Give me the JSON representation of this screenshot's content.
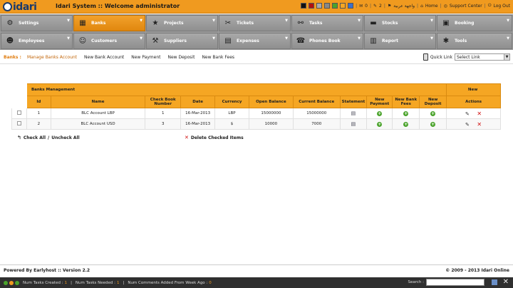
{
  "header": {
    "logo_text": "idari",
    "title": "Idari System :: Welcome administrator",
    "swatches": [
      "#111111",
      "#b01010",
      "#aaaaaa",
      "#888888",
      "#4aa32b",
      "#f5a623",
      "#3c6fc9"
    ],
    "msg_count": "0",
    "task_count": "2",
    "arabic_label": "واجهة عربية",
    "home": "Home",
    "support": "Support Center",
    "logout": "Log Out"
  },
  "menu": {
    "row1": [
      {
        "label": "Settings",
        "icon": "wrench-icon"
      },
      {
        "label": "Banks",
        "icon": "bank-icon"
      },
      {
        "label": "Projects",
        "icon": "star-icon"
      },
      {
        "label": "Tickets",
        "icon": "ticket-icon"
      },
      {
        "label": "Tasks",
        "icon": "tasks-icon"
      },
      {
        "label": "Stocks",
        "icon": "truck-icon"
      },
      {
        "label": "Booking",
        "icon": "booking-icon"
      }
    ],
    "row2": [
      {
        "label": "Employees",
        "icon": "employees-icon"
      },
      {
        "label": "Customers",
        "icon": "customers-icon"
      },
      {
        "label": "Suppliers",
        "icon": "suppliers-icon"
      },
      {
        "label": "Expenses",
        "icon": "briefcase-icon"
      },
      {
        "label": "Phones Book",
        "icon": "phone-icon"
      },
      {
        "label": "Report",
        "icon": "report-icon"
      },
      {
        "label": "Tools",
        "icon": "tools-icon"
      }
    ]
  },
  "submenu": {
    "label": "Banks :",
    "links": [
      "Manage Banks Account",
      "New Bank Account",
      "New Payment",
      "New Deposit",
      "New Bank Fees"
    ],
    "quick_label": "Quick Link",
    "quick_value": "Select Link"
  },
  "table": {
    "section_title": "Banks Management",
    "new_label": "New",
    "headers": [
      "Id",
      "Name",
      "Check Book Number",
      "Date",
      "Currency",
      "Open Balance",
      "Current Balance",
      "Statement",
      "New Payment",
      "New Bank Fees",
      "New Deposit",
      "Actions"
    ],
    "rows": [
      {
        "id": "1",
        "name": "BLC Account LBP",
        "check_book": "1",
        "date": "16-Mar-2013",
        "currency": "LBP",
        "open_balance": "15000000",
        "current_balance": "15000000"
      },
      {
        "id": "2",
        "name": "BLC Account USD",
        "check_book": "3",
        "date": "16-Mar-2013",
        "currency": "$",
        "open_balance": "10000",
        "current_balance": "7000"
      }
    ]
  },
  "actions": {
    "check_all": "Check All",
    "separator": "/",
    "uncheck_all": "Uncheck All",
    "delete_checked": "Delete Checked Items"
  },
  "footer": {
    "powered_prefix": "Powered By Earlyhost",
    "version": ":: Version 2.2",
    "copyright": "© 2009 - 2013 Idari Online"
  },
  "statusbar": {
    "num_tasks_created": "Num Tasks Created :",
    "num_tasks_created_val": "1",
    "num_tasks_needed": "Num Tasks Needed :",
    "num_tasks_needed_val": "1",
    "num_comments": "Num Comments Added From Week Ago :",
    "num_comments_val": "0",
    "search_label": "Search :"
  }
}
